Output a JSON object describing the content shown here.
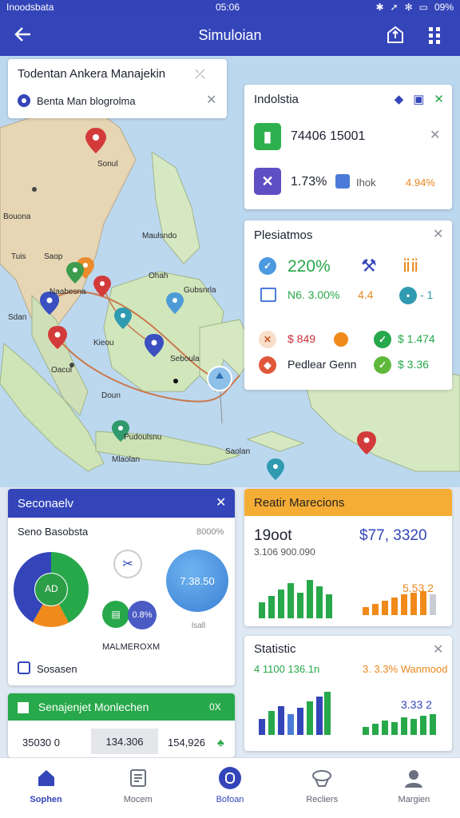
{
  "status_bar": {
    "carrier": "Inoodsbata",
    "time": "05:06",
    "battery": "09%"
  },
  "app_bar": {
    "title": "Simuloian"
  },
  "map": {
    "labels": [
      "Bouona",
      "Maulsndo",
      "Saop",
      "Ohah",
      "Gubsnrla",
      "Tuis",
      "Seboula",
      "Doun",
      "Pudoulsnu",
      "Oacul",
      "Kieou",
      "Mlaolan",
      "Saolan",
      "Sdan",
      "Naabesna",
      "Sonul"
    ]
  },
  "search_card": {
    "title": "Todentan Ankera Manajekin",
    "subtitle": "Benta Man blogrolma"
  },
  "industry_card": {
    "title": "Indolstia",
    "row1_value": "74406 15001",
    "row2_percent": "1.73%",
    "row2_label": "Ihok",
    "row2_right": "4.94%"
  },
  "plan_card": {
    "title": "Plesiatmos",
    "big_percent": "220%",
    "row2_value": "N6. 3.00%",
    "row2_mid": "4.4",
    "row2_right": "- 1",
    "row3_value": "$ 849",
    "row3_right": "$ 1.474",
    "row4_label": "Pedlear Genn",
    "row4_right": "$ 3.36"
  },
  "secondary_card": {
    "title": "Seconaelv",
    "subtitle": "Seno Basobsta",
    "subtitle_right": "8000%",
    "donut_center": "AD",
    "circle_value": "7.38.50",
    "circle_label": "lsall",
    "badge_value": "0.8%",
    "section_label": "MALMEROXM",
    "footer": "Sosasen"
  },
  "realtime_card": {
    "title": "Reatir Marecions",
    "big_value": "19oot",
    "sub_value": "3.106 900.090",
    "price": "$77, 3320",
    "small_value": "5.53 2"
  },
  "statistic_card": {
    "title": "Statistic",
    "value_left": "4 1100 136.1n",
    "value_right": "3. 3.3% Wanmood",
    "chart_value": "3.33 2"
  },
  "green_card": {
    "title": "Senajenjet Monlechen",
    "badge": "0X",
    "value1": "35030 0",
    "value2": "134.306",
    "value3": "154,926"
  },
  "bottom_nav": [
    {
      "label": "Sophen",
      "icon": "home-icon"
    },
    {
      "label": "Mocem",
      "icon": "list-icon"
    },
    {
      "label": "Bofoan",
      "icon": "circle-icon"
    },
    {
      "label": "Recliers",
      "icon": "hat-icon"
    },
    {
      "label": "Margien",
      "icon": "person-icon"
    }
  ],
  "colors": {
    "primary": "#3345b9",
    "green": "#27a84a",
    "orange": "#f6ad35",
    "blue": "#4b7bd9"
  }
}
